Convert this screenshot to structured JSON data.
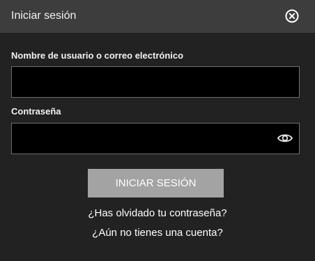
{
  "header": {
    "title": "Iniciar sesión",
    "close_icon": "close-circle-icon"
  },
  "form": {
    "username_label": "Nombre de usuario o correo electrónico",
    "username_value": "",
    "password_label": "Contraseña",
    "password_value": "",
    "show_password_icon": "eye-icon",
    "submit_label": "INICIAR SESIÓN"
  },
  "links": {
    "forgot_password": "¿Has olvidado tu contraseña?",
    "signup": "¿Aún no tienes una cuenta?"
  },
  "colors": {
    "background": "#222222",
    "header_background": "#3d3d3d",
    "input_background": "#000000",
    "input_border": "#6e6e6e",
    "button_background": "#a3a3a3",
    "text": "#f2f2f2"
  }
}
